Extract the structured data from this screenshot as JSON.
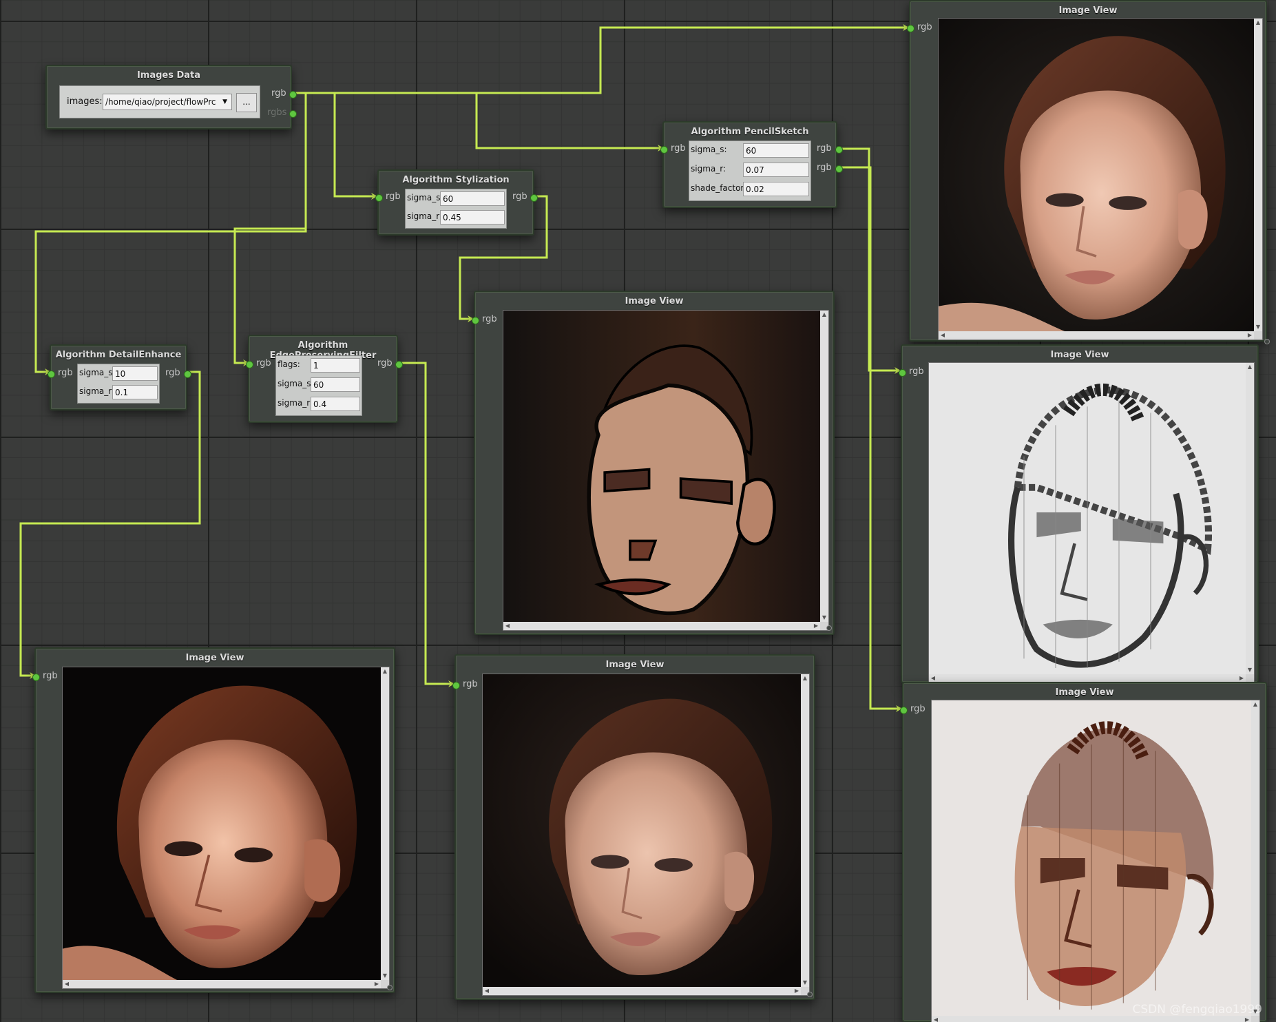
{
  "colors": {
    "wire": "#c6ea52",
    "port": "#5fc640",
    "canvas": "#3a3b3a",
    "node": "#3f4440"
  },
  "images_data": {
    "title": "Images Data",
    "images_label": "images:",
    "images_value": "/home/qiao/project/flowPrc",
    "browse_label": "...",
    "out_rgb": "rgb",
    "out_rgbs": "rgbs"
  },
  "stylization": {
    "title": "Algorithm Stylization",
    "in_rgb": "rgb",
    "out_rgb": "rgb",
    "params": [
      {
        "label": "sigma_s:",
        "value": "60"
      },
      {
        "label": "sigma_r:",
        "value": "0.45"
      }
    ]
  },
  "pencil_sketch": {
    "title": "Algorithm PencilSketch",
    "in_rgb": "rgb",
    "out_rgb_1": "rgb",
    "out_rgb_2": "rgb",
    "params": [
      {
        "label": "sigma_s:",
        "value": "60"
      },
      {
        "label": "sigma_r:",
        "value": "0.07"
      },
      {
        "label": "shade_factor:",
        "value": "0.02"
      }
    ]
  },
  "detail_enhance": {
    "title": "Algorithm DetailEnhance",
    "in_rgb": "rgb",
    "out_rgb": "rgb",
    "params": [
      {
        "label": "sigma_s:",
        "value": "10"
      },
      {
        "label": "sigma_r:",
        "value": "0.1"
      }
    ]
  },
  "edge_preserving": {
    "title": "Algorithm EdgePreservingFilter",
    "in_rgb": "rgb",
    "out_rgb": "rgb",
    "params": [
      {
        "label": "flags:",
        "value": "1"
      },
      {
        "label": "sigma_s:",
        "value": "60"
      },
      {
        "label": "sigma_r:",
        "value": "0.4"
      }
    ]
  },
  "image_views": [
    {
      "title": "Image View",
      "in_rgb": "rgb",
      "variant": "original"
    },
    {
      "title": "Image View",
      "in_rgb": "rgb",
      "variant": "stylized"
    },
    {
      "title": "Image View",
      "in_rgb": "rgb",
      "variant": "pencil-gray"
    },
    {
      "title": "Image View",
      "in_rgb": "rgb",
      "variant": "pencil-color"
    },
    {
      "title": "Image View",
      "in_rgb": "rgb",
      "variant": "detail"
    },
    {
      "title": "Image View",
      "in_rgb": "rgb",
      "variant": "edge-preserve"
    }
  ],
  "watermark": "CSDN @fengqiao1999"
}
